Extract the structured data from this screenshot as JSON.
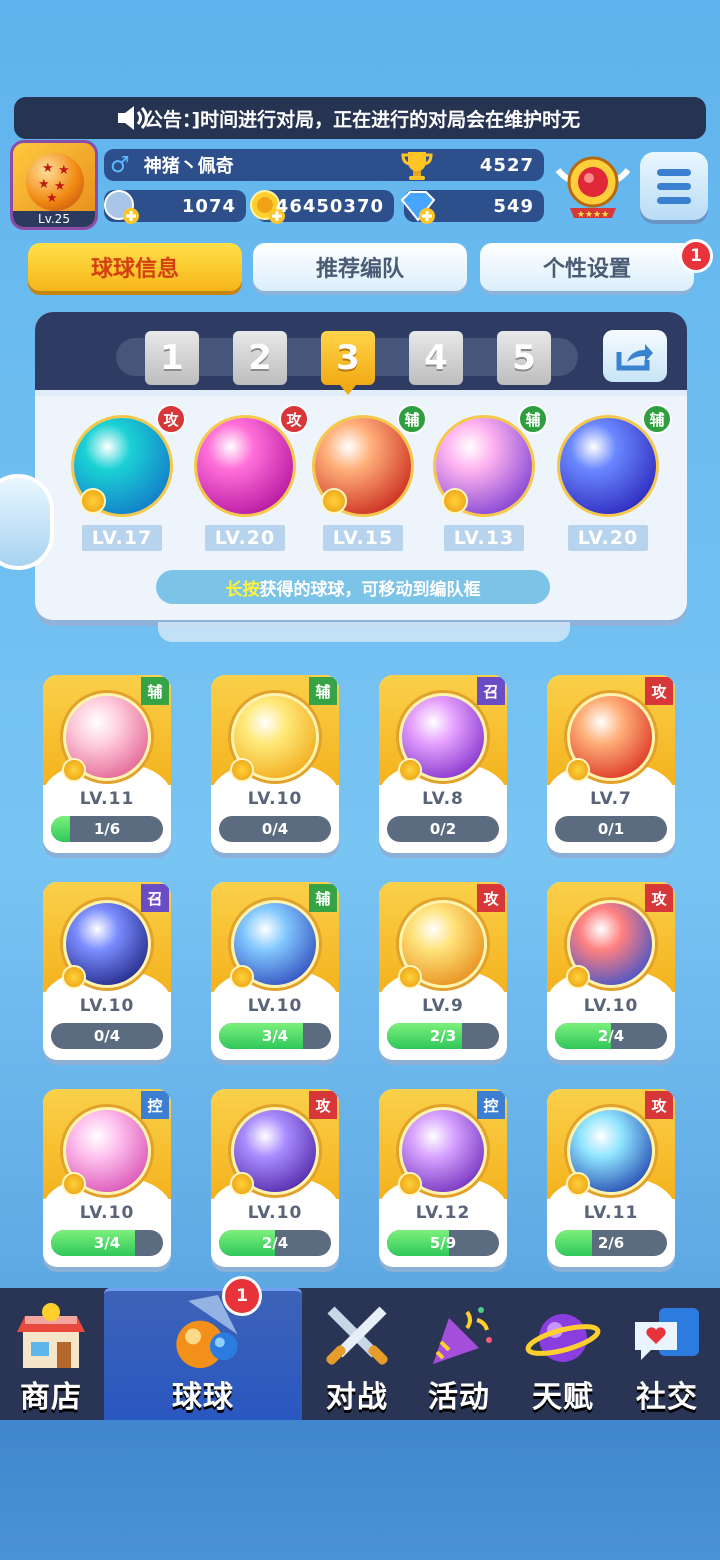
{
  "announcement": {
    "text": "公告：]时间进行对局，正在进行的对局会在维护时无"
  },
  "player": {
    "level": "Lv.25",
    "name": "神猪丶佩奇",
    "gender_icon": "male-icon",
    "trophies": "4527",
    "energy": "1074",
    "coins": "46450370",
    "gems": "549"
  },
  "tabs": [
    {
      "label": "球球信息",
      "active": true
    },
    {
      "label": "推荐编队",
      "active": false
    },
    {
      "label": "个性设置",
      "active": false,
      "badge": "1"
    }
  ],
  "team_slots": [
    "1",
    "2",
    "3",
    "4",
    "5"
  ],
  "selected_slot": "3",
  "team": [
    {
      "level": "LV.17",
      "tag": "攻",
      "type": "atk",
      "colors": [
        "#1bd1d4",
        "#1376c9"
      ]
    },
    {
      "level": "LV.20",
      "tag": "攻",
      "type": "atk",
      "colors": [
        "#ff6fd8",
        "#b1129c"
      ]
    },
    {
      "level": "LV.15",
      "tag": "辅",
      "type": "sup",
      "colors": [
        "#ffb07a",
        "#c9241a"
      ]
    },
    {
      "level": "LV.13",
      "tag": "辅",
      "type": "sup",
      "colors": [
        "#ffb4f0",
        "#7b3ed1"
      ]
    },
    {
      "level": "LV.20",
      "tag": "辅",
      "type": "sup",
      "colors": [
        "#6a88ff",
        "#2a24b9"
      ]
    }
  ],
  "hint": {
    "highlight": "长按",
    "text": "获得的球球，可移动到编队框"
  },
  "collection": [
    {
      "level": "LV.11",
      "tag": "辅",
      "type": "sup",
      "progress": "1/6",
      "ratio": 0.167,
      "colors": [
        "#ffd0e0",
        "#e05a8a"
      ]
    },
    {
      "level": "LV.10",
      "tag": "辅",
      "type": "sup",
      "progress": "0/4",
      "ratio": 0,
      "colors": [
        "#ffe97a",
        "#f0a512"
      ]
    },
    {
      "level": "LV.8",
      "tag": "召",
      "type": "sum",
      "progress": "0/2",
      "ratio": 0,
      "colors": [
        "#e6a2ff",
        "#7a28c6"
      ]
    },
    {
      "level": "LV.7",
      "tag": "攻",
      "type": "atk",
      "progress": "0/1",
      "ratio": 0,
      "colors": [
        "#ffb07a",
        "#d8281a"
      ]
    },
    {
      "level": "LV.10",
      "tag": "召",
      "type": "sum",
      "progress": "0/4",
      "ratio": 0,
      "colors": [
        "#7a8cff",
        "#1a1f7a"
      ]
    },
    {
      "level": "LV.10",
      "tag": "辅",
      "type": "sup",
      "progress": "3/4",
      "ratio": 0.75,
      "colors": [
        "#82c8ff",
        "#2a43b8"
      ]
    },
    {
      "level": "LV.9",
      "tag": "攻",
      "type": "atk",
      "progress": "2/3",
      "ratio": 0.667,
      "colors": [
        "#ffe27a",
        "#e58512"
      ]
    },
    {
      "level": "LV.10",
      "tag": "攻",
      "type": "atk",
      "progress": "2/4",
      "ratio": 0.5,
      "colors": [
        "#ff8080",
        "#2f4fd1"
      ]
    },
    {
      "level": "LV.10",
      "tag": "控",
      "type": "ctl",
      "progress": "3/4",
      "ratio": 0.75,
      "colors": [
        "#ffc2ee",
        "#d548b0"
      ]
    },
    {
      "level": "LV.10",
      "tag": "攻",
      "type": "atk",
      "progress": "2/4",
      "ratio": 0.5,
      "colors": [
        "#a88cff",
        "#4a1fa0"
      ]
    },
    {
      "level": "LV.12",
      "tag": "控",
      "type": "ctl",
      "progress": "5/9",
      "ratio": 0.556,
      "colors": [
        "#d7a2ff",
        "#6a27b8"
      ]
    },
    {
      "level": "LV.11",
      "tag": "攻",
      "type": "atk",
      "progress": "2/6",
      "ratio": 0.333,
      "colors": [
        "#8fe4ff",
        "#1a3aa8"
      ]
    }
  ],
  "nav": [
    {
      "label": "商店",
      "icon": "shop-icon"
    },
    {
      "label": "球球",
      "icon": "ball-icon",
      "active": true,
      "badge": "1"
    },
    {
      "label": "对战",
      "icon": "crossed-swords-icon"
    },
    {
      "label": "活动",
      "icon": "party-popper-icon"
    },
    {
      "label": "天赋",
      "icon": "planet-icon"
    },
    {
      "label": "社交",
      "icon": "chat-heart-icon"
    }
  ]
}
